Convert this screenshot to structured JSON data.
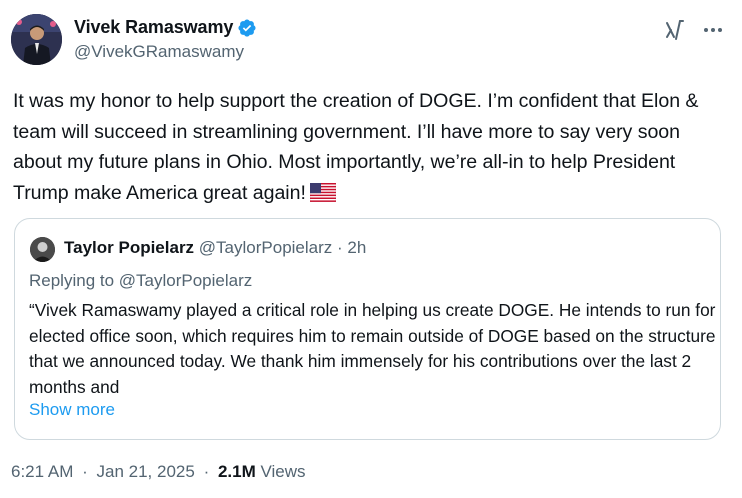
{
  "author": {
    "display_name": "Vivek Ramaswamy",
    "handle": "@VivekGRamaswamy",
    "verified_icon": "verified-badge-icon"
  },
  "tweet": {
    "text": "It was my honor to help support the creation of DOGE. I’m confident that Elon & team will succeed in streamlining government. I’ll have more to say very soon about my future plans in Ohio. Most importantly, we’re all-in to help President Trump make America great again!",
    "emoji": "us-flag-icon"
  },
  "quote": {
    "display_name": "Taylor Popielarz",
    "handle": "@TaylorPopielarz",
    "separator": "·",
    "time": "2h",
    "replying_to": "Replying to @TaylorPopielarz",
    "text": "“Vivek Ramaswamy played a critical role in helping us create DOGE. He intends to run for elected office soon, which requires him to remain outside of DOGE based on the structure that we announced today. We thank him immensely for his contributions over the last 2 months and",
    "show_more": "Show more"
  },
  "meta": {
    "time": "6:21 AM",
    "sep1": "·",
    "date": "Jan 21, 2025",
    "sep2": "·",
    "views_count": "2.1M",
    "views_label": "Views"
  },
  "colors": {
    "text": "#0f1419",
    "secondary": "#536471",
    "link": "#1d9bf0",
    "border": "#cfd9de",
    "verified": "#1d9bf0"
  }
}
